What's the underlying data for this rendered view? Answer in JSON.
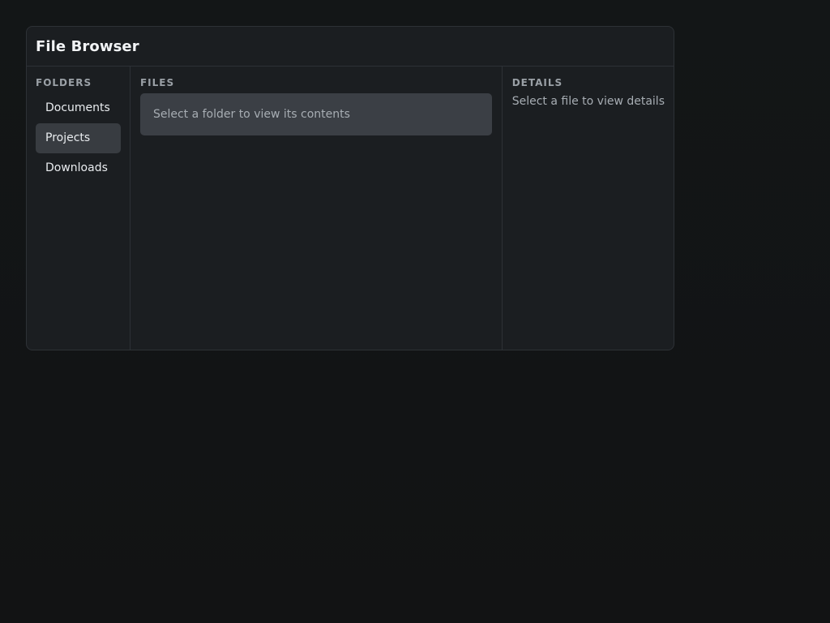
{
  "window": {
    "title": "File Browser"
  },
  "folders": {
    "section_title": "FOLDERS",
    "items": [
      {
        "label": "Documents",
        "selected": false
      },
      {
        "label": "Projects",
        "selected": true
      },
      {
        "label": "Downloads",
        "selected": false
      }
    ]
  },
  "files": {
    "section_title": "FILES",
    "empty_message": "Select a folder to view its contents"
  },
  "details": {
    "section_title": "DETAILS",
    "empty_message": "Select a file to view details"
  },
  "colors": {
    "background": "#111213",
    "panel": "#1b1e21",
    "border": "#2d3136",
    "selected_item": "#383c41",
    "empty_box": "#3b3f45"
  }
}
